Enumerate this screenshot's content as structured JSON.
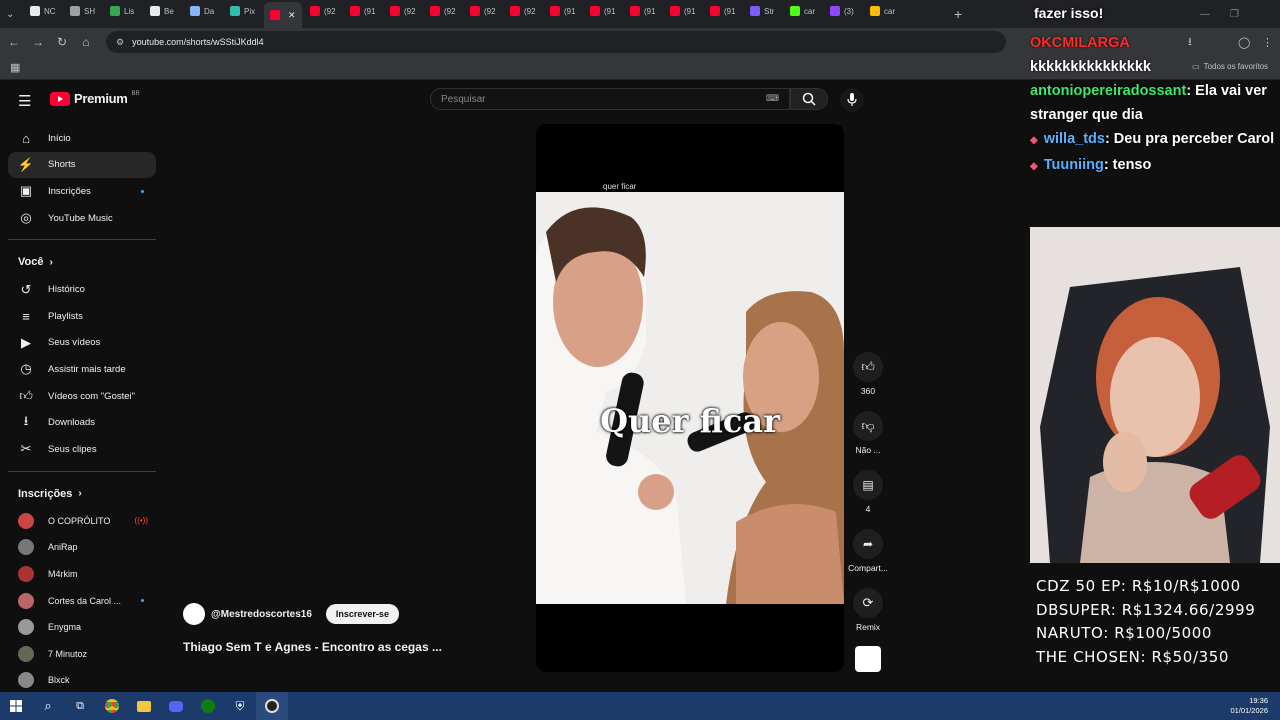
{
  "browser": {
    "tabs": [
      {
        "label": "NC",
        "color": "#e8eaed"
      },
      {
        "label": "SH",
        "color": "#9aa0a6"
      },
      {
        "label": "Lis",
        "color": "#34a853"
      },
      {
        "label": "Be",
        "color": "#e8eaed"
      },
      {
        "label": "Da",
        "color": "#8ab4f8"
      },
      {
        "label": "Pix",
        "color": "#32bcad"
      },
      {
        "label": "",
        "color": "#ff0033"
      },
      {
        "label": "(92",
        "color": "#ff0033"
      },
      {
        "label": "(91",
        "color": "#ff0033"
      },
      {
        "label": "(92",
        "color": "#ff0033"
      },
      {
        "label": "(92",
        "color": "#ff0033"
      },
      {
        "label": "(92",
        "color": "#ff0033"
      },
      {
        "label": "(92",
        "color": "#ff0033"
      },
      {
        "label": "(91",
        "color": "#ff0033"
      },
      {
        "label": "(91",
        "color": "#ff0033"
      },
      {
        "label": "(91",
        "color": "#ff0033"
      },
      {
        "label": "(91",
        "color": "#ff0033"
      },
      {
        "label": "(91",
        "color": "#ff0033"
      },
      {
        "label": "Str",
        "color": "#7c5cff"
      },
      {
        "label": "car",
        "color": "#53fc18"
      },
      {
        "label": "(3)",
        "color": "#9146ff"
      },
      {
        "label": "car",
        "color": "#fbbc04"
      }
    ],
    "url": "youtube.com/shorts/wSStiJKddl4",
    "bookmarks_label": "Todos os favoritos"
  },
  "youtube": {
    "logo_text": "Premium",
    "region": "BR",
    "search_placeholder": "Pesquisar",
    "sidebar_main": [
      {
        "label": "Início",
        "icon": "home-icon"
      },
      {
        "label": "Shorts",
        "icon": "shorts-icon"
      },
      {
        "label": "Inscrições",
        "icon": "subscriptions-icon"
      },
      {
        "label": "YouTube Music",
        "icon": "music-icon"
      }
    ],
    "you_header": "Você",
    "sidebar_you": [
      {
        "label": "Histórico",
        "icon": "history-icon"
      },
      {
        "label": "Playlists",
        "icon": "playlists-icon"
      },
      {
        "label": "Seus vídeos",
        "icon": "your-videos-icon"
      },
      {
        "label": "Assistir mais tarde",
        "icon": "watch-later-icon"
      },
      {
        "label": "Vídeos com \"Gostei\"",
        "icon": "liked-icon"
      },
      {
        "label": "Downloads",
        "icon": "download-icon"
      },
      {
        "label": "Seus clipes",
        "icon": "clips-icon"
      }
    ],
    "subs_header": "Inscrições",
    "subscriptions": [
      {
        "label": "O COPRÓLITO",
        "live": true
      },
      {
        "label": "AniRap",
        "live": false
      },
      {
        "label": "M4rkim",
        "live": false
      },
      {
        "label": "Cortes da Carol ...",
        "live": false
      },
      {
        "label": "Enygma",
        "live": false
      },
      {
        "label": "7 Minutoz",
        "live": false
      },
      {
        "label": "Blxck",
        "live": false
      }
    ],
    "short": {
      "top_caption": "quer ficar",
      "caption": "Quer ficar",
      "channel": "@Mestredoscortes16",
      "subscribe": "Inscrever-se",
      "title": "Thiago Sem T e Agnes - Encontro as cegas ..."
    },
    "actions": {
      "like_count": "360",
      "dislike_label": "Não ...",
      "comments_count": "4",
      "share_label": "Compart...",
      "remix_label": "Remix"
    }
  },
  "overlay": {
    "top_text": "fazer isso!",
    "chat": [
      {
        "user": "OKCMILARGA",
        "text": "",
        "color": "#ff2a2a"
      },
      {
        "user": "",
        "text": "kkkkkkkkkkkkkkk",
        "color": "#ffffff"
      },
      {
        "user": "antoniopereiradossant",
        "text": ": Ela vai ver stranger que dia",
        "color": "#3ee66a"
      },
      {
        "user": "willa_tds",
        "text": ": Deu pra perceber Carol",
        "color": "#5ab0ff"
      },
      {
        "user": "Tuuniing",
        "text": ": tenso",
        "color": "#5ab0ff"
      }
    ],
    "goals": [
      "CDZ 50 EP: R$10/R$1000",
      "DBSUPER: R$1324.66/2999",
      "NARUTO: R$100/5000",
      "THE CHOSEN: R$50/350"
    ]
  },
  "taskbar": {
    "time": "19:36",
    "date": "01/01/2026"
  }
}
